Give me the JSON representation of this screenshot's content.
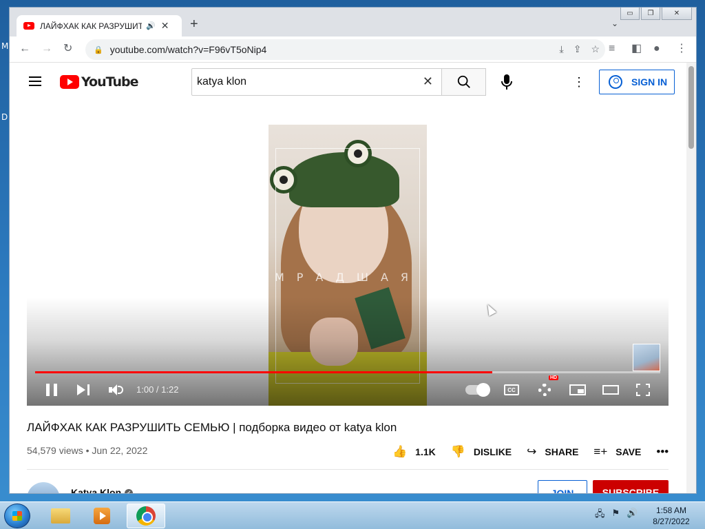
{
  "desktop": {
    "side_letters": [
      "M",
      "D"
    ]
  },
  "browser": {
    "tab": {
      "title": "ЛАЙФХАК КАК РАЗРУШИТЬ",
      "audio_icon": "speaker-icon",
      "close": "✕"
    },
    "new_tab": "+",
    "tab_search": "⌄",
    "window_controls": {
      "minimize": "▭",
      "restore": "❐",
      "close": "✕"
    },
    "nav": {
      "back": "←",
      "forward": "→",
      "reload": "↻"
    },
    "url": "youtube.com/watch?v=F96vT5oNip4",
    "omnibox_icons": [
      "⤓",
      "⇪",
      "☆"
    ],
    "right_icons": [
      "≡",
      "◧",
      "●",
      "⋮"
    ]
  },
  "youtube": {
    "logo_text": "YouTube",
    "search": {
      "query": "katya klon",
      "clear": "✕"
    },
    "sign_in": "SIGN IN",
    "more": "⋮",
    "player": {
      "overlay_text": "МРАДШАЯ",
      "time": "1:00 / 1:22",
      "progress": 0.731,
      "hd_badge": "HD",
      "cc": "CC"
    },
    "video": {
      "title": "ЛАЙФХАК КАК РАЗРУШИТЬ СЕМЬЮ | подборка видео от katya klon",
      "meta": "54,579 views • Jun 22, 2022",
      "actions": [
        {
          "icon": "👍",
          "label": "1.1K"
        },
        {
          "icon": "👎",
          "label": "DISLIKE"
        },
        {
          "icon": "↪",
          "label": "SHARE"
        },
        {
          "icon": "≡+",
          "label": "SAVE"
        },
        {
          "icon": "•••",
          "label": ""
        }
      ]
    },
    "channel": {
      "name": "Katya Klon",
      "verified": "✓",
      "join": "JOIN",
      "subscribe": "SUBSCRIBE"
    }
  },
  "taskbar": {
    "clock_time": "1:58 AM",
    "clock_date": "8/27/2022",
    "tray_icons": [
      "🖧",
      "⚑",
      "🔊"
    ]
  }
}
